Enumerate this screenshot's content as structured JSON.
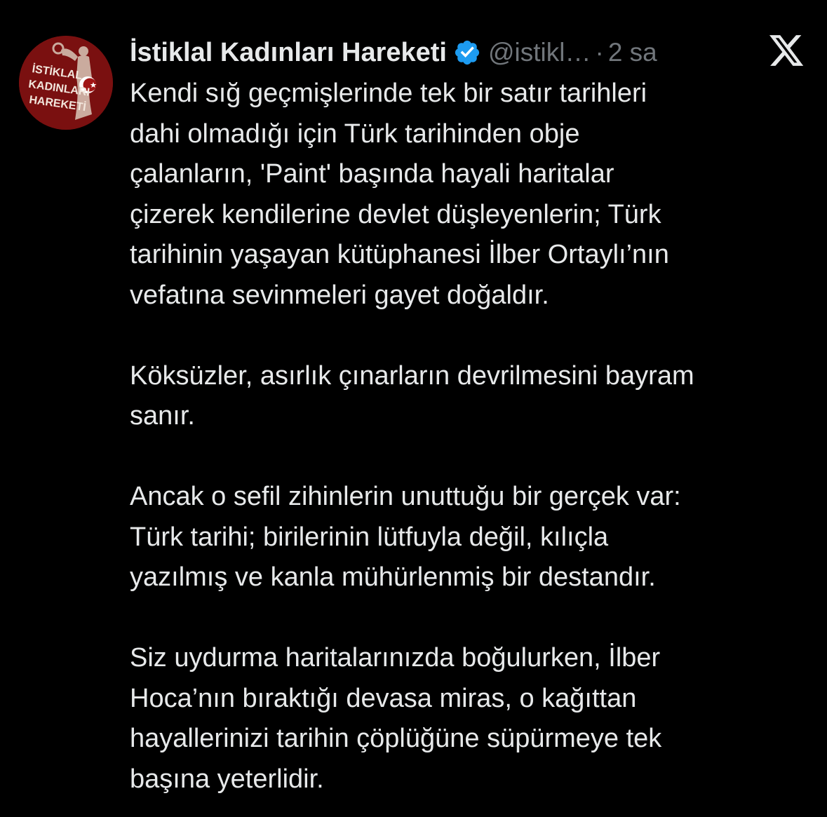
{
  "tweet": {
    "display_name": "İstiklal Kadınları Hareketi",
    "handle": "@istikl…",
    "separator": "·",
    "time": "2 sa",
    "avatar": {
      "icon": "profile-avatar",
      "lines": [
        "İSTİKLAL",
        "KADINLARI",
        "HAREKETİ"
      ],
      "bg_color": "#7a1010"
    },
    "verified_icon": "verified-badge-icon",
    "verified_color": "#1d9bf0",
    "brand_icon": "x-logo-icon",
    "paragraphs": [
      [
        "Kendi sığ geçmişlerinde tek bir satır tarihleri",
        "dahi olmadığı için Türk tarihinden obje",
        "çalanların, 'Paint' başında hayali haritalar",
        "çizerek kendilerine devlet düşleyenlerin; Türk",
        "tarihinin yaşayan kütüphanesi İlber Ortaylı’nın",
        "vefatına sevinmeleri gayet doğaldır."
      ],
      [
        "Köksüzler, asırlık çınarların devrilmesini bayram",
        "sanır."
      ],
      [
        "Ancak o sefil zihinlerin unuttuğu bir gerçek var:",
        "Türk tarihi; birilerinin lütfuyla değil, kılıçla",
        "yazılmış ve kanla mühürlenmiş bir destandır."
      ],
      [
        "Siz uydurma haritalarınızda boğulurken, İlber",
        "Hoca’nın bıraktığı devasa miras, o kağıttan",
        "hayallerinizi tarihin çöplüğüne süpürmeye tek",
        "başına yeterlidir."
      ]
    ]
  }
}
